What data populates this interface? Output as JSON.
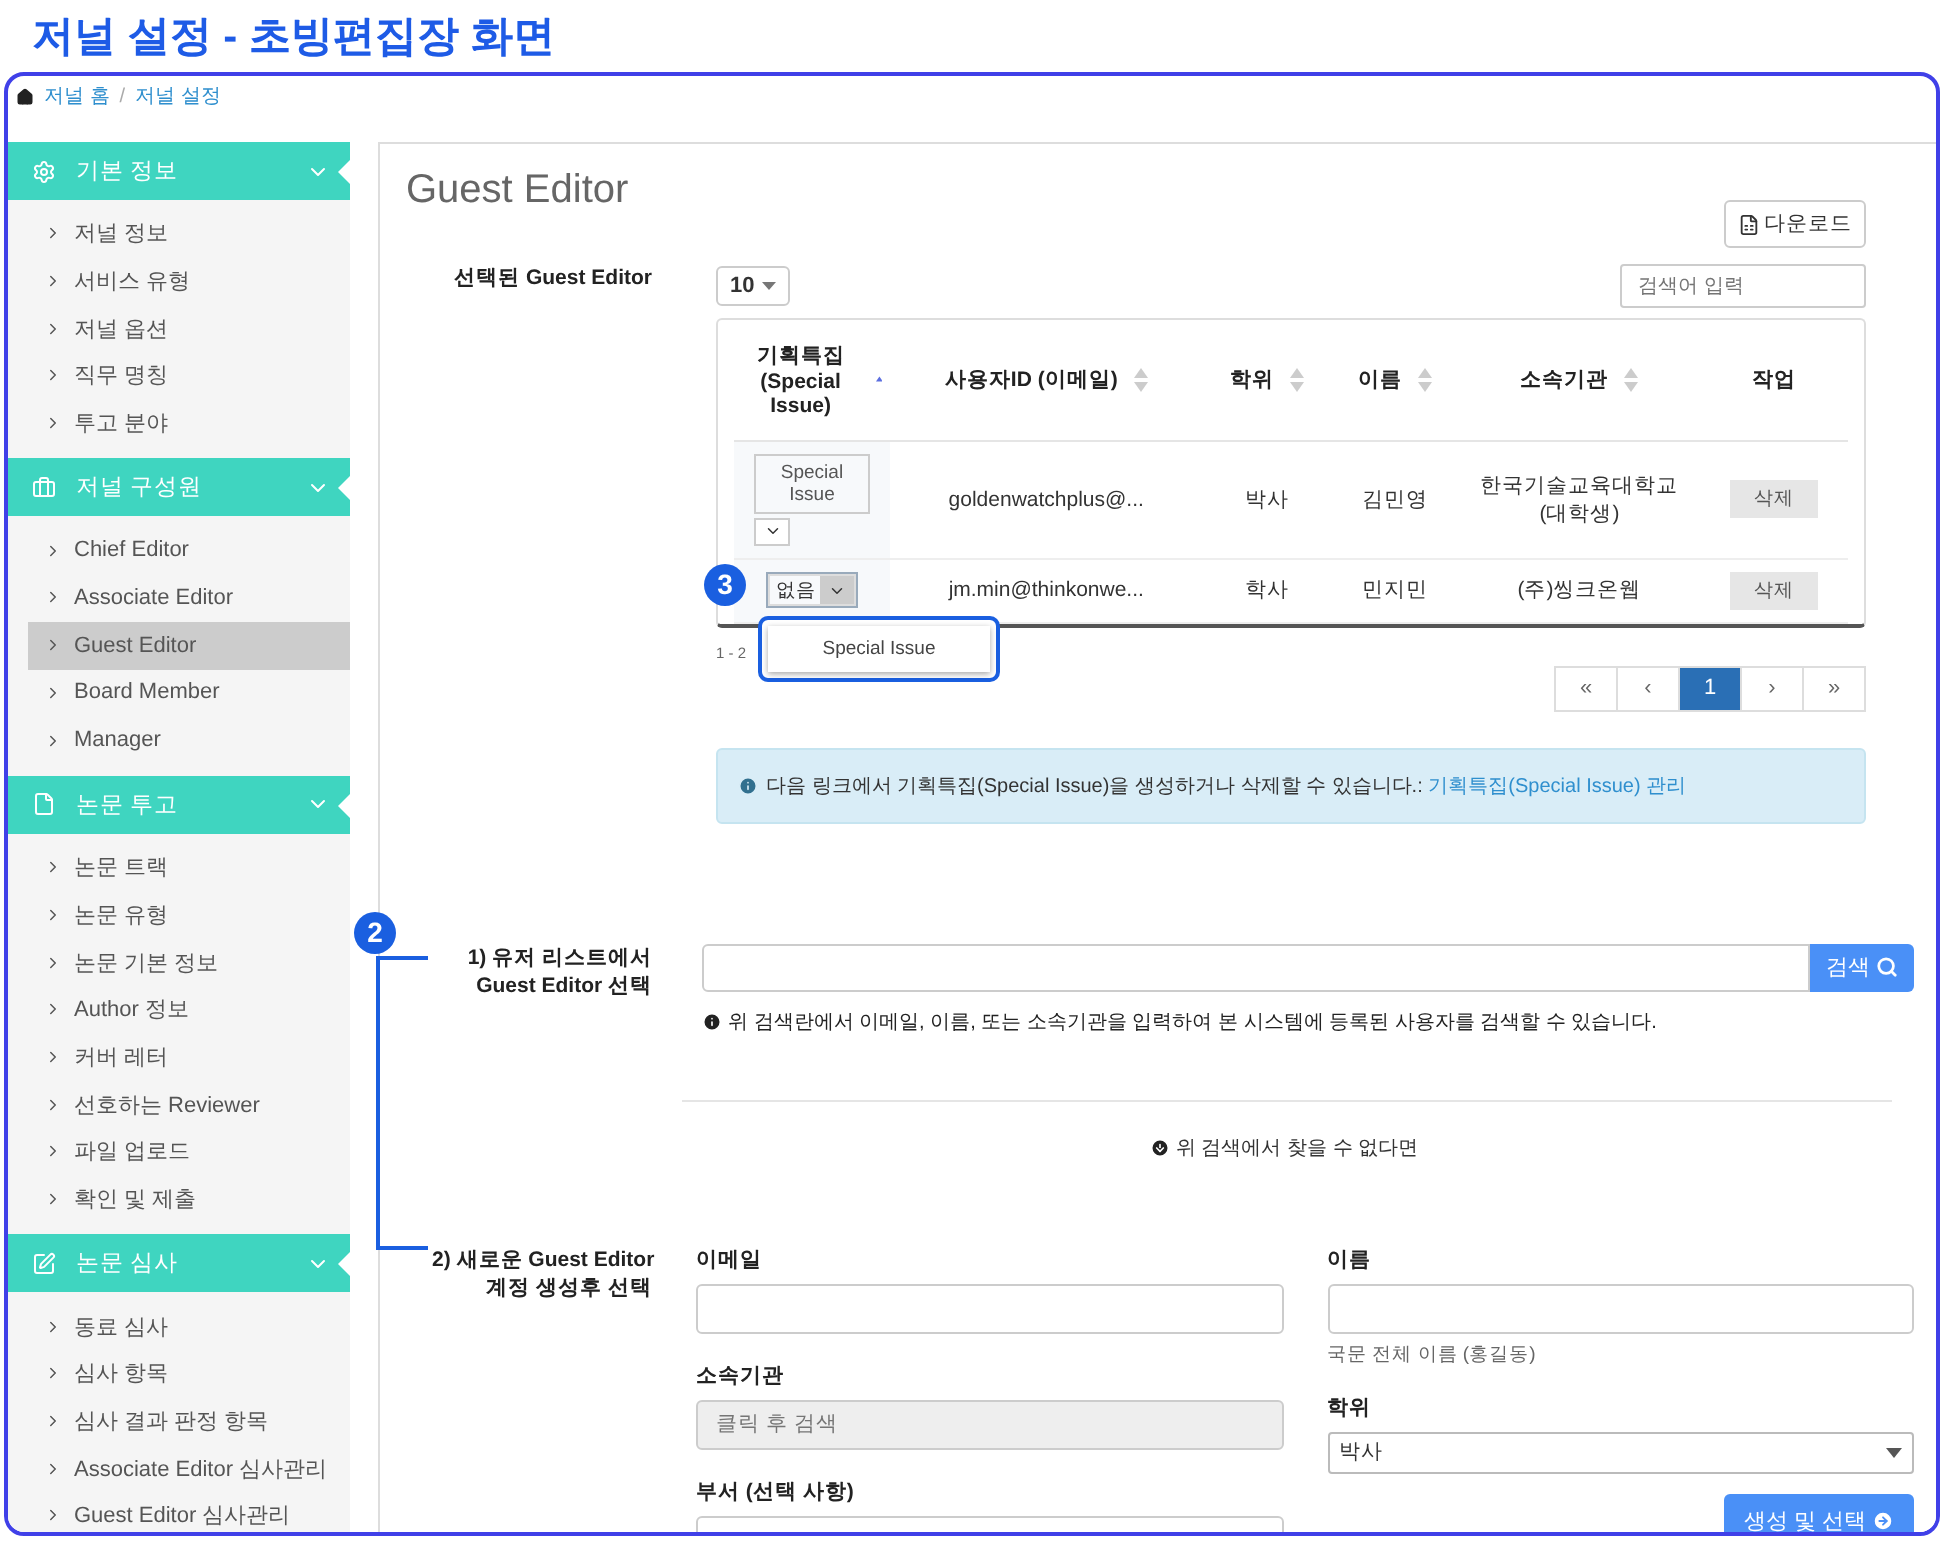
{
  "page_title": "저널 설정 - 초빙편집장 화면",
  "breadcrumb": [
    {
      "label": "저널 홈"
    },
    {
      "label": "저널 설정"
    }
  ],
  "breadcrumb_separator": "/",
  "sidebar": [
    {
      "title": "기본 정보",
      "expanded": true,
      "items": [
        {
          "label": "저널 정보",
          "selected": false
        },
        {
          "label": "서비스 유형",
          "selected": false
        },
        {
          "label": "저널 옵션",
          "selected": false
        },
        {
          "label": "직무 명칭",
          "selected": false
        },
        {
          "label": "투고 분야",
          "selected": false
        }
      ]
    },
    {
      "title": "저널 구성원",
      "expanded": true,
      "items": [
        {
          "label": "Chief Editor",
          "selected": false
        },
        {
          "label": "Associate Editor",
          "selected": false
        },
        {
          "label": "Guest Editor",
          "selected": true
        },
        {
          "label": "Board Member",
          "selected": false
        },
        {
          "label": "Manager",
          "selected": false
        }
      ]
    },
    {
      "title": "논문 투고",
      "expanded": true,
      "items": [
        {
          "label": "논문 트랙",
          "selected": false
        },
        {
          "label": "논문 유형",
          "selected": false
        },
        {
          "label": "논문 기본 정보",
          "selected": false
        },
        {
          "label": "Author 정보",
          "selected": false
        },
        {
          "label": "커버 레터",
          "selected": false
        },
        {
          "label": "선호하는 Reviewer",
          "selected": false
        },
        {
          "label": "파일 업로드",
          "selected": false
        },
        {
          "label": "확인 및 제출",
          "selected": false
        }
      ]
    },
    {
      "title": "논문 심사",
      "expanded": true,
      "items": [
        {
          "label": "동료 심사",
          "selected": false
        },
        {
          "label": "심사 항목",
          "selected": false
        },
        {
          "label": "심사 결과 판정 항목",
          "selected": false
        },
        {
          "label": "Associate Editor 심사관리",
          "selected": false
        },
        {
          "label": "Guest Editor 심사관리",
          "selected": false
        }
      ]
    }
  ],
  "main": {
    "title": "Guest Editor",
    "download_button": "다운로드",
    "selected_section": {
      "label": "선택된 Guest Editor",
      "page_size": "10",
      "search_placeholder": "검색어 입력",
      "columns": [
        {
          "label": "기획특집 (Special Issue)",
          "sorted": true
        },
        {
          "label": "사용자ID (이메일)",
          "sorted": false
        },
        {
          "label": "학위",
          "sorted": false
        },
        {
          "label": "이름",
          "sorted": false
        },
        {
          "label": "소속기관",
          "sorted": false
        },
        {
          "label": "작업"
        }
      ],
      "rows": [
        {
          "special_issue": "Special Issue",
          "open": false,
          "email": "goldenwatchplus@...",
          "degree": "박사",
          "name": "김민영",
          "affiliation": "한국기술교육대학교 (대학생)",
          "action": "삭제"
        },
        {
          "special_issue": "없음",
          "open": true,
          "menu_options": [
            {
              "label": "Special Issue"
            }
          ],
          "annotation": "3",
          "email": "jm.min@thinkonwe...",
          "degree": "학사",
          "name": "민지민",
          "affiliation": "(주)씽크온웹",
          "action": "삭제"
        }
      ],
      "footer": "1 - 2",
      "pagination": [
        {
          "label": "«",
          "selected": false
        },
        {
          "label": "‹",
          "selected": false
        },
        {
          "label": "1",
          "selected": true
        },
        {
          "label": "›",
          "selected": false
        },
        {
          "label": "»",
          "selected": false
        }
      ],
      "alert": {
        "text": "다음 링크에서 기획특집(Special Issue)을 생성하거나 삭제할 수 있습니다.:",
        "link": "기획특집(Special Issue) 관리"
      }
    },
    "user_search": {
      "annotation": "2",
      "label": "1) 유저 리스트에서\nGuest Editor 선택",
      "button": "검색",
      "help": "위 검색란에서 이메일, 이름, 또는 소속기관을 입력하여 본 시스템에 등록된 사용자를 검색할 수 있습니다."
    },
    "not_found": "위 검색에서 찾을 수 없다면",
    "new_account": {
      "label": "2) 새로운 Guest Editor\n계정 생성후 선택",
      "fields": [
        {
          "label": "이메일",
          "kind": "text"
        },
        {
          "label": "이름",
          "kind": "text",
          "hint": "국문 전체 이름 (홍길동)"
        },
        {
          "label": "소속기관",
          "kind": "disabled",
          "placeholder": "클릭 후 검색"
        },
        {
          "label": "학위",
          "kind": "select",
          "value": "박사"
        },
        {
          "label": "부서 (선택 사항)",
          "kind": "text"
        }
      ],
      "submit": "생성 및 선택"
    }
  }
}
